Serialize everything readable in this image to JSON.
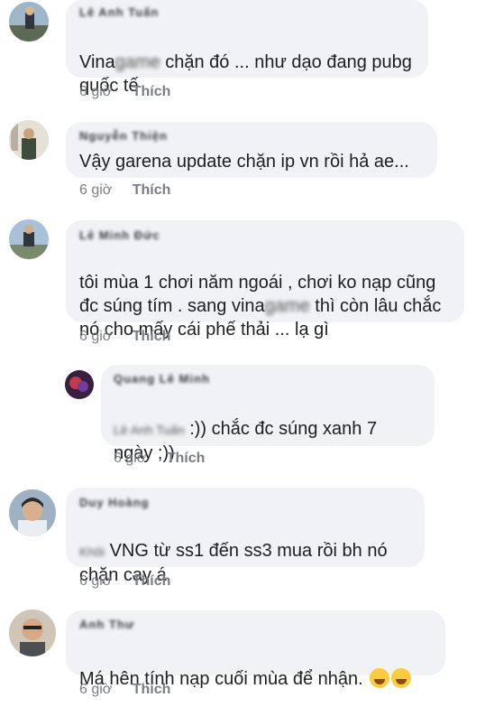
{
  "comments": [
    {
      "name": "Lê Anh Tuấn",
      "text_before": "Vina",
      "text_blur": "game",
      "text_after": " chặn đó ... như dạo đang pubg\nquốc tế",
      "time": "6 giờ",
      "like": "Thích"
    },
    {
      "name": "Nguyễn Thiện",
      "text": "Vậy garena update chặn ip vn rồi hả ae...",
      "time": "6 giờ",
      "like": "Thích"
    },
    {
      "name": "Lê Minh Đức",
      "text_line1": "tôi mùa 1 chơi năm ngoái , chơi ko nạp cũng",
      "text_line2_before": "đc súng tím . sang vina",
      "text_line2_blur": "game",
      "text_line2_after": " thì còn lâu chắc",
      "text_line3": "nó cho mấy cái phế thải ... lạ gì",
      "time": "6 giờ",
      "like": "Thích"
    },
    {
      "name": "Quang Lê Minh",
      "mention": "Lê Anh Tuấn",
      "text_after": " :)) chắc đc súng xanh 7",
      "text_line2": "ngày ;))",
      "time": "6 giờ",
      "like": "Thích"
    },
    {
      "name": "Duy Hoàng",
      "mention": "Khôi",
      "text_after": " VNG từ ss1 đến ss3 mua rồi bh nó",
      "text_line2": "chặn cay á",
      "time": "6 giờ",
      "like": "Thích"
    },
    {
      "name": "Anh Thư",
      "text": "Má hên tính nạp cuối mùa để nhận. ",
      "time": "6 giờ",
      "like": "Thích"
    }
  ]
}
